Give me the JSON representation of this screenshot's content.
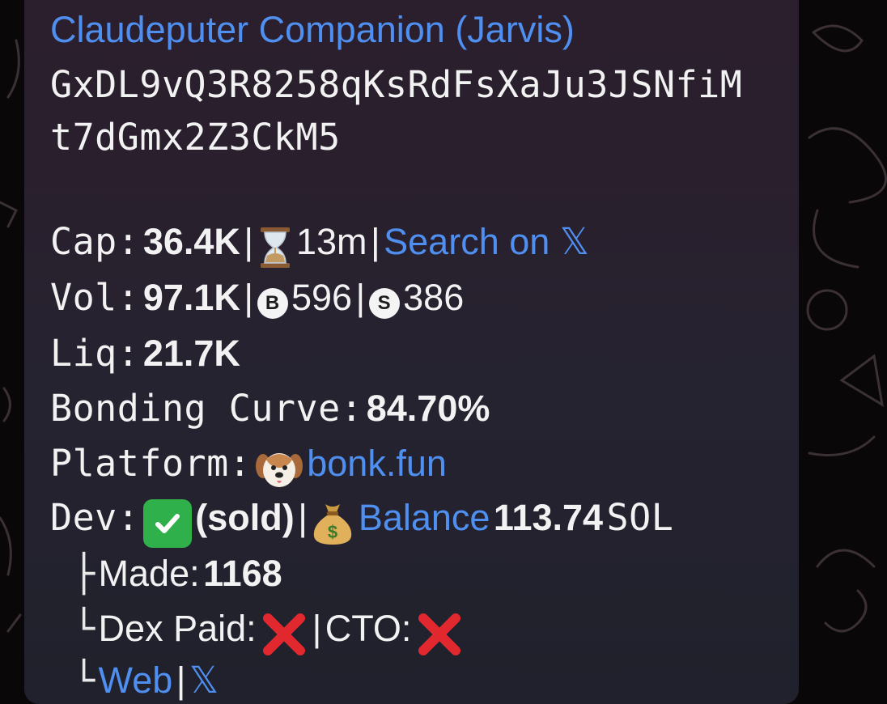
{
  "message": {
    "title": "Claudeputer Companion (Jarvis)",
    "address_line1": "GxDL9vQ3R8258qKsRdFsXaJu3JSNfiM",
    "address_line2": "t7dGmx2Z3CkM5",
    "cap": {
      "label": "Cap:",
      "value": "36.4K",
      "sep1": "|",
      "age": "13m",
      "sep2": "|",
      "search_link": "Search on 𝕏"
    },
    "vol": {
      "label": "Vol:",
      "value": "97.1K",
      "sep1": "|",
      "buy_badge": "B",
      "buys": "596",
      "sep2": "|",
      "sell_badge": "S",
      "sells": "386"
    },
    "liq": {
      "label": "Liq:",
      "value": "21.7K"
    },
    "bonding": {
      "label": "Bonding Curve:",
      "value": "84.70%"
    },
    "platform": {
      "label": "Platform:",
      "link": "bonk.fun"
    },
    "dev": {
      "label": "Dev:",
      "status": "(sold)",
      "sep": "|",
      "balance_link": "Balance",
      "balance_value": "113.74",
      "balance_unit": "SOL"
    },
    "made": {
      "branch": "├",
      "label": "Made:",
      "value": "1168"
    },
    "dex": {
      "branch": "└",
      "label": "Dex Paid:",
      "sep": "|",
      "cto_label": "CTO:"
    },
    "links": {
      "branch": "└",
      "web": "Web",
      "sep": "|",
      "x": "𝕏"
    }
  },
  "colors": {
    "link": "#4f8ff0",
    "text": "#f2f2f2",
    "bubble": "#2a2030",
    "check_bg": "#2fb04a",
    "cross": "#e0282e"
  },
  "icons": [
    "hourglass-icon",
    "buy-badge-icon",
    "sell-badge-icon",
    "dog-face-icon",
    "check-mark-icon",
    "money-bag-icon",
    "cross-mark-icon"
  ]
}
